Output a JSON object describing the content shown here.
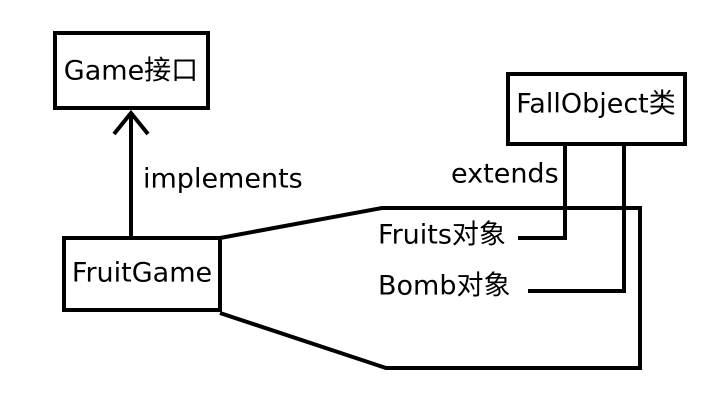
{
  "nodes": {
    "game_interface": "Game接口",
    "fall_object_class": "FallObject类",
    "fruit_game": "FruitGame",
    "fruits_object": "Fruits对象",
    "bomb_object": "Bomb对象"
  },
  "edges": {
    "implements_label": "implements",
    "extends_label": "extends"
  }
}
